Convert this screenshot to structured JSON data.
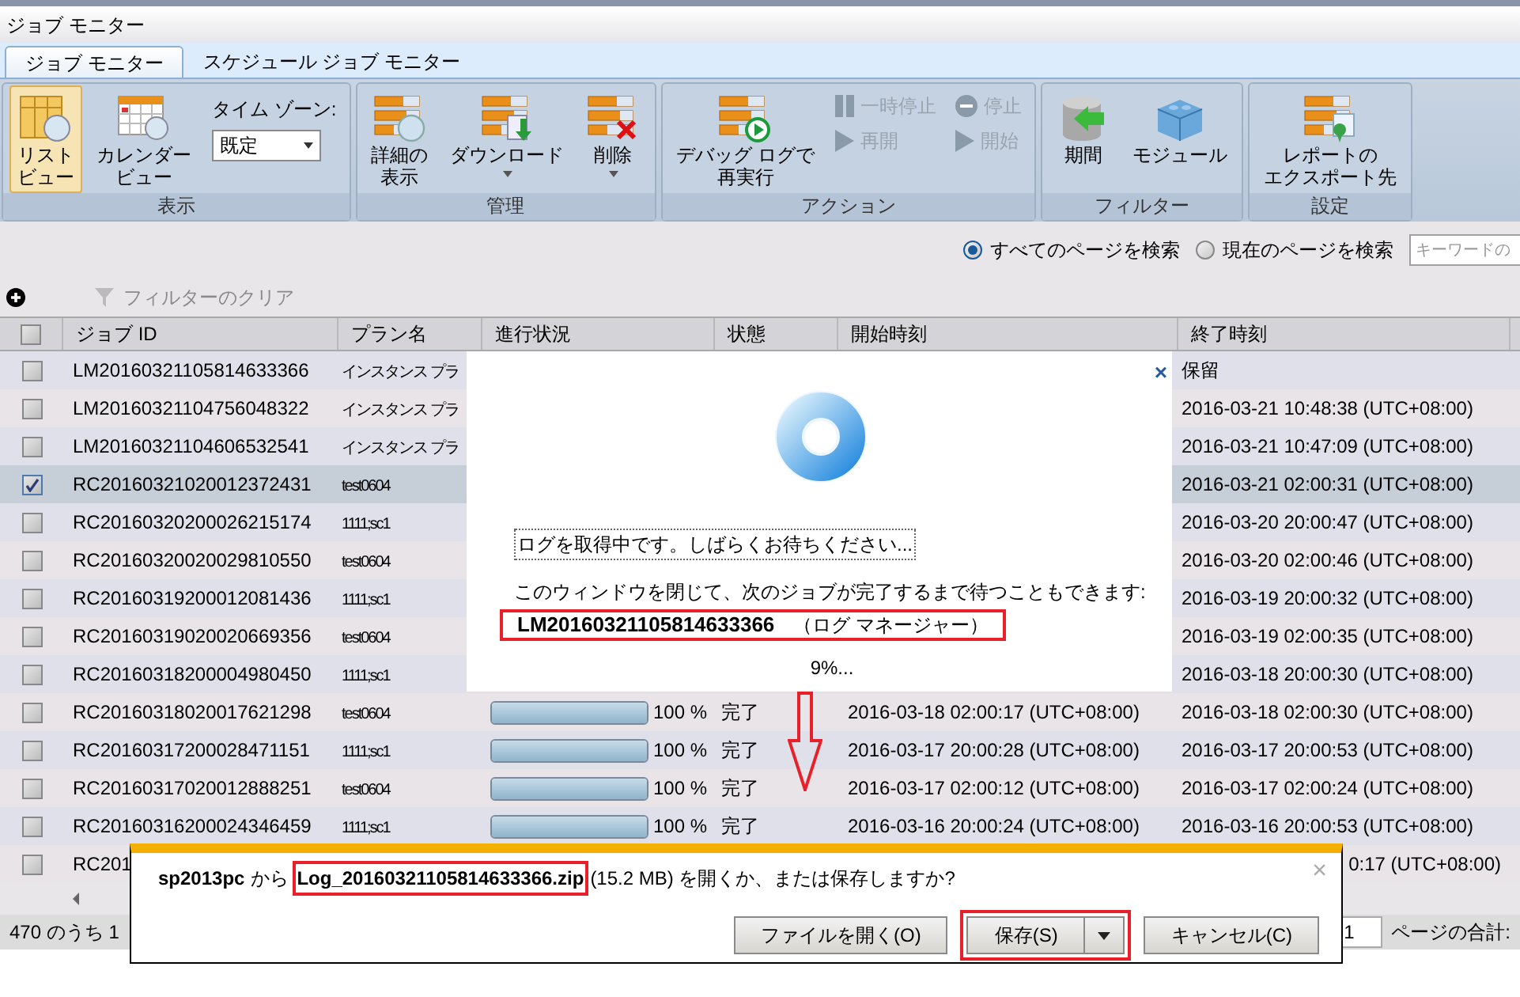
{
  "window": {
    "title": "ジョブ モニター"
  },
  "tabs": [
    {
      "label": "ジョブ モニター",
      "selected": true
    },
    {
      "label": "スケジュール ジョブ モニター",
      "selected": false
    }
  ],
  "ribbon": {
    "groups": [
      {
        "label": "表示",
        "items": [
          {
            "kind": "large",
            "lines": [
              "リスト",
              "ビュー"
            ],
            "selected": true,
            "caret": false
          },
          {
            "kind": "large",
            "lines": [
              "カレンダー",
              "ビュー"
            ],
            "selected": false,
            "caret": false
          },
          {
            "kind": "select",
            "label": "タイム ゾーン:",
            "value": "既定"
          }
        ]
      },
      {
        "label": "管理",
        "items": [
          {
            "kind": "large",
            "lines": [
              "詳細の",
              "表示"
            ],
            "selected": false,
            "caret": false
          },
          {
            "kind": "large",
            "lines": [
              "ダウンロード"
            ],
            "selected": false,
            "caret": true
          },
          {
            "kind": "large",
            "lines": [
              "削除"
            ],
            "selected": false,
            "caret": true
          }
        ]
      },
      {
        "label": "アクション",
        "items": [
          {
            "kind": "large",
            "lines": [
              "デバッグ ログで",
              "再実行"
            ],
            "selected": false,
            "caret": false
          },
          {
            "kind": "small_column",
            "buttons": [
              {
                "label": "一時停止",
                "disabled": true
              },
              {
                "label": "再開",
                "disabled": true
              }
            ]
          },
          {
            "kind": "small_column",
            "buttons": [
              {
                "label": "停止",
                "disabled": true
              },
              {
                "label": "開始",
                "disabled": true
              }
            ]
          }
        ]
      },
      {
        "label": "フィルター",
        "items": [
          {
            "kind": "large",
            "lines": [
              "期間"
            ],
            "selected": false,
            "caret": false
          },
          {
            "kind": "large",
            "lines": [
              "モジュール"
            ],
            "selected": false,
            "caret": false
          }
        ]
      },
      {
        "label": "設定",
        "items": [
          {
            "kind": "large",
            "lines": [
              "レポートの",
              "エクスポート先"
            ],
            "selected": false,
            "caret": false
          }
        ]
      }
    ]
  },
  "search": {
    "options": [
      {
        "label": "すべてのページを検索",
        "selected": true
      },
      {
        "label": "現在のページを検索",
        "selected": false
      }
    ],
    "placeholder": "キーワードの"
  },
  "toolbar": {
    "clear_filter": {
      "label": "フィルターのクリア",
      "disabled": true
    }
  },
  "table": {
    "select_all": {
      "checked": false
    },
    "columns": [
      "ジョブ ID",
      "プラン名",
      "進行状況",
      "状態",
      "開始時刻",
      "終了時刻"
    ],
    "rows": [
      {
        "job_id": "LM20160321105814633366",
        "plan": "インスタンス プラ",
        "end": "保留",
        "checked": false,
        "selected": false
      },
      {
        "job_id": "LM20160321104756048322",
        "plan": "インスタンス プラ",
        "end": "2016-03-21 10:48:38 (UTC+08:00)",
        "checked": false,
        "selected": false
      },
      {
        "job_id": "LM20160321104606532541",
        "plan": "インスタンス プラ",
        "end": "2016-03-21 10:47:09 (UTC+08:00)",
        "checked": false,
        "selected": false
      },
      {
        "job_id": "RC20160321020012372431",
        "plan": "test0604",
        "end": "2016-03-21 02:00:31 (UTC+08:00)",
        "checked": true,
        "selected": true
      },
      {
        "job_id": "RC20160320200026215174",
        "plan": "1111;sc1",
        "end": "2016-03-20 20:00:47 (UTC+08:00)",
        "checked": false,
        "selected": false
      },
      {
        "job_id": "RC20160320020029810550",
        "plan": "test0604",
        "end": "2016-03-20 02:00:46 (UTC+08:00)",
        "checked": false,
        "selected": false
      },
      {
        "job_id": "RC20160319200012081436",
        "plan": "1111;sc1",
        "end": "2016-03-19 20:00:32 (UTC+08:00)",
        "checked": false,
        "selected": false
      },
      {
        "job_id": "RC20160319020020669356",
        "plan": "test0604",
        "end": "2016-03-19 02:00:35 (UTC+08:00)",
        "checked": false,
        "selected": false
      },
      {
        "job_id": "RC20160318200004980450",
        "plan": "1111;sc1",
        "end": "2016-03-18 20:00:30 (UTC+08:00)",
        "checked": false,
        "selected": false
      },
      {
        "job_id": "RC20160318020017621298",
        "plan": "test0604",
        "level": 1,
        "reading": "100 %",
        "status": "完了",
        "start": "2016-03-18 02:00:17 (UTC+08:00)",
        "end": "2016-03-18 02:00:30 (UTC+08:00)",
        "checked": false,
        "selected": false
      },
      {
        "job_id": "RC20160317200028471151",
        "plan": "1111;sc1",
        "level": 1,
        "reading": "100 %",
        "status": "完了",
        "start": "2016-03-17 20:00:28 (UTC+08:00)",
        "end": "2016-03-17 20:00:53 (UTC+08:00)",
        "checked": false,
        "selected": false
      },
      {
        "job_id": "RC20160317020012888251",
        "plan": "test0604",
        "level": 1,
        "reading": "100 %",
        "status": "完了",
        "start": "2016-03-17 02:00:12 (UTC+08:00)",
        "end": "2016-03-17 02:00:24 (UTC+08:00)",
        "checked": false,
        "selected": false
      },
      {
        "job_id": "RC20160316200024346459",
        "plan": "1111;sc1",
        "level": 1,
        "reading": "100 %",
        "status": "完了",
        "start": "2016-03-16 20:00:24 (UTC+08:00)",
        "end": "2016-03-16 20:00:53 (UTC+08:00)",
        "checked": false,
        "selected": false
      },
      {
        "job_id": "RC201",
        "end": "0:17 (UTC+08:00)",
        "checked": false,
        "selected": false
      }
    ]
  },
  "status_bar": {
    "summary": "470 のうち 1",
    "page_value": "1",
    "page_total_label": "ページの合計:"
  },
  "loading_dialog": {
    "close": "×",
    "message": "ログを取得中です。しばらくお待ちください...",
    "hint": "このウィンドウを閉じて、次のジョブが完了するまで待つこともできます:",
    "job_id": "LM20160321105814633366",
    "job_type": "（ログ マネージャー）",
    "highlighted": true,
    "progress": "9%..."
  },
  "download_bar": {
    "source": "sp2013pc",
    "from": "から",
    "filename": "Log_20160321105814633366.zip",
    "filename_highlighted": true,
    "question": "(15.2 MB) を開くか、または保存しますか?",
    "close": "×",
    "buttons": [
      {
        "label": "ファイルを開く(O)",
        "kind": "plain",
        "highlighted": false
      },
      {
        "label": "保存(S)",
        "kind": "split",
        "highlighted": true
      },
      {
        "label": "キャンセル(C)",
        "kind": "plain",
        "highlighted": false
      }
    ]
  }
}
